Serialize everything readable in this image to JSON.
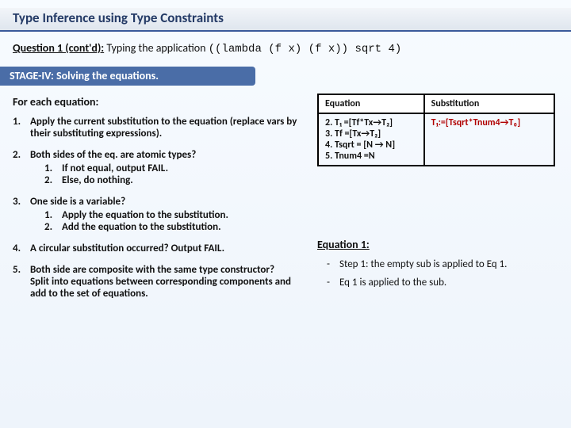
{
  "title": "Type Inference using Type Constraints",
  "question": {
    "label": "Question 1 (cont'd):",
    "lead": "  Typing the application ",
    "code": "((lambda (f x) (f x)) sqrt 4)"
  },
  "stage_label": "STAGE-IV: Solving the equations.",
  "foreach": "For each equation:",
  "steps": [
    {
      "num": "1.",
      "head": "Apply the current substitution to the equation (replace vars by their substituting expressions).",
      "subs": []
    },
    {
      "num": "2.",
      "head": "Both sides of the eq. are atomic types?",
      "subs": [
        {
          "n": "1.",
          "t": "If not equal, output FAIL."
        },
        {
          "n": "2.",
          "t": "Else, do nothing."
        }
      ]
    },
    {
      "num": "3.",
      "head": "One side is a variable?",
      "subs": [
        {
          "n": "1.",
          "t": "Apply the equation to the substitution."
        },
        {
          "n": "2.",
          "t": "Add the equation to the substitution."
        }
      ]
    },
    {
      "num": "4.",
      "head": "A circular substitution occurred? Output FAIL.",
      "subs": []
    },
    {
      "num": "5.",
      "head": "Both side are composite with the same type constructor?",
      "tail": "Split into equations between corresponding components and add to the set of equations.",
      "subs": []
    }
  ],
  "table": {
    "headers": [
      "Equation",
      "Substitution"
    ],
    "eq_rows": [
      "2. T₁ =[Tf*Tx→T₂]",
      "3. Tf =[Tx→T₂]",
      "4. Tsqrt = [N → N]",
      "5. Tnum4 =N"
    ],
    "sub_cell": "T₁:=[Tsqrt*Tnum4→T₀]"
  },
  "eq1": {
    "label": "Equation 1:",
    "items": [
      "Step 1: the empty sub is applied to Eq 1.",
      "Eq 1 is applied to the sub."
    ]
  }
}
